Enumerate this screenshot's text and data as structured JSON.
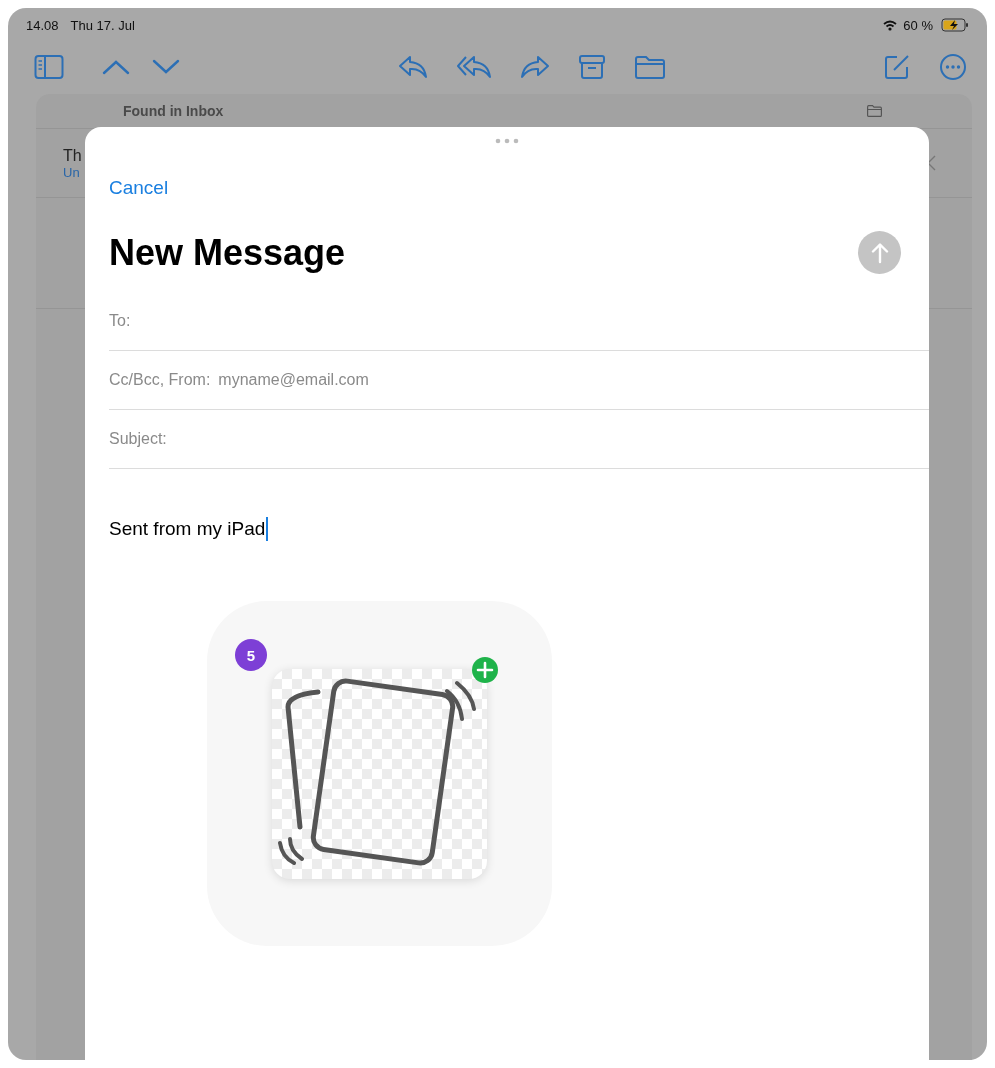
{
  "status_bar": {
    "time": "14.08",
    "date": "Thu 17. Jul",
    "battery": "60 %"
  },
  "background_list": {
    "header": "Found in Inbox",
    "row": {
      "title": "Th",
      "subtitle": "Un"
    }
  },
  "compose": {
    "cancel": "Cancel",
    "title": "New Message",
    "send_disabled": true,
    "fields": [
      {
        "label": "To:"
      },
      {
        "label": "Cc/Bcc, From:",
        "value": "myname@email.com"
      },
      {
        "label": "Subject:"
      }
    ],
    "body": "Sent from my iPad",
    "drag_preview": {
      "count": "5"
    }
  }
}
